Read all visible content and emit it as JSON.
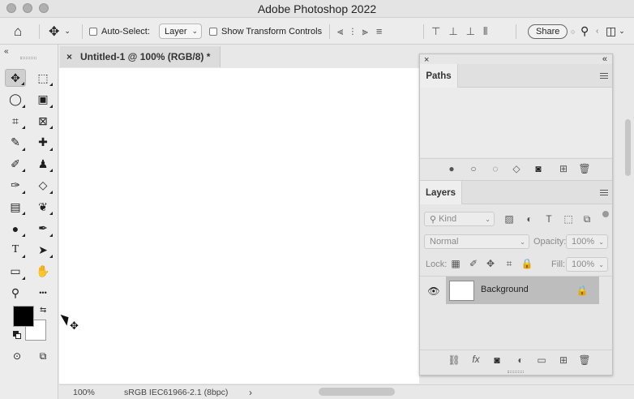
{
  "window": {
    "title": "Adobe Photoshop 2022"
  },
  "options_bar": {
    "auto_select_label": "Auto-Select:",
    "layer_dropdown_value": "Layer",
    "show_transform_label": "Show Transform Controls",
    "share_label": "Share"
  },
  "toolbar": {
    "tools": [
      {
        "name": "move-tool",
        "glyph": "✥"
      },
      {
        "name": "marquee-tool",
        "glyph": "⬚"
      },
      {
        "name": "lasso-tool",
        "glyph": "◯"
      },
      {
        "name": "object-select-tool",
        "glyph": "▣"
      },
      {
        "name": "crop-tool",
        "glyph": "⌗"
      },
      {
        "name": "frame-tool",
        "glyph": "⊠"
      },
      {
        "name": "eyedropper-tool",
        "glyph": "✎"
      },
      {
        "name": "healing-brush-tool",
        "glyph": "✚"
      },
      {
        "name": "brush-tool",
        "glyph": "✐"
      },
      {
        "name": "stamp-tool",
        "glyph": "♟"
      },
      {
        "name": "history-brush-tool",
        "glyph": "✑"
      },
      {
        "name": "eraser-tool",
        "glyph": "◇"
      },
      {
        "name": "gradient-tool",
        "glyph": "▤"
      },
      {
        "name": "blur-tool",
        "glyph": "❦"
      },
      {
        "name": "dodge-tool",
        "glyph": "●"
      },
      {
        "name": "pen-tool",
        "glyph": "✒"
      },
      {
        "name": "type-tool",
        "glyph": "T"
      },
      {
        "name": "path-select-tool",
        "glyph": "➤"
      },
      {
        "name": "rectangle-tool",
        "glyph": "▭"
      },
      {
        "name": "hand-tool",
        "glyph": "✋"
      },
      {
        "name": "zoom-tool",
        "glyph": "⚲"
      },
      {
        "name": "more-tools",
        "glyph": "•••"
      }
    ],
    "foreground_color": "#000000",
    "background_color": "#ffffff"
  },
  "document": {
    "tab_title": "Untitled-1 @ 100% (RGB/8) *",
    "close_glyph": "×"
  },
  "status_bar": {
    "zoom": "100%",
    "profile": "sRGB IEC61966-2.1 (8bpc)",
    "arrow": "›"
  },
  "paths_panel": {
    "tab_label": "Paths",
    "close_glyph": "×",
    "collapse_glyph": "«"
  },
  "layers_panel": {
    "tab_label": "Layers",
    "kind_placeholder": "Kind",
    "blend_mode": "Normal",
    "opacity_label": "Opacity:",
    "opacity_value": "100%",
    "lock_label": "Lock:",
    "fill_label": "Fill:",
    "fill_value": "100%",
    "layers": [
      {
        "name": "Background",
        "visible": true,
        "locked": true
      }
    ]
  }
}
